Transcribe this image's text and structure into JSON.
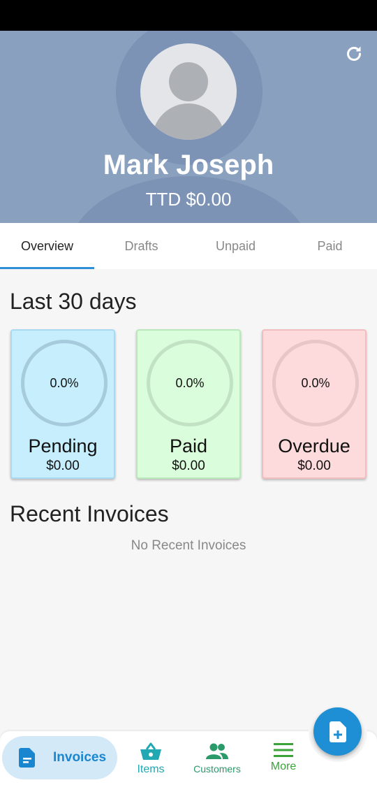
{
  "profile": {
    "name": "Mark Joseph",
    "balance": "TTD $0.00"
  },
  "tabs": [
    {
      "label": "Overview",
      "active": true
    },
    {
      "label": "Drafts",
      "active": false
    },
    {
      "label": "Unpaid",
      "active": false
    },
    {
      "label": "Paid",
      "active": false
    }
  ],
  "summary": {
    "title": "Last 30 days",
    "cards": [
      {
        "label": "Pending",
        "percent": "0.0%",
        "amount": "$0.00",
        "color": "#c7eefd"
      },
      {
        "label": "Paid",
        "percent": "0.0%",
        "amount": "$0.00",
        "color": "#dafddb"
      },
      {
        "label": "Overdue",
        "percent": "0.0%",
        "amount": "$0.00",
        "color": "#fddadb"
      }
    ]
  },
  "recent": {
    "title": "Recent Invoices",
    "empty_message": "No Recent Invoices"
  },
  "bottom_nav": {
    "items": [
      {
        "label": "Invoices",
        "icon": "invoice-document-icon",
        "active": true
      },
      {
        "label": "Items",
        "icon": "basket-icon",
        "active": false
      },
      {
        "label": "Customers",
        "icon": "people-icon",
        "active": false
      },
      {
        "label": "More",
        "icon": "menu-icon",
        "active": false
      }
    ]
  },
  "fab": {
    "icon": "new-document-icon"
  },
  "colors": {
    "header": "#8aa0bf",
    "accent": "#1e8fd4",
    "items": "#22a8b2",
    "customers": "#2a9a6a",
    "more": "#3aa33a"
  }
}
